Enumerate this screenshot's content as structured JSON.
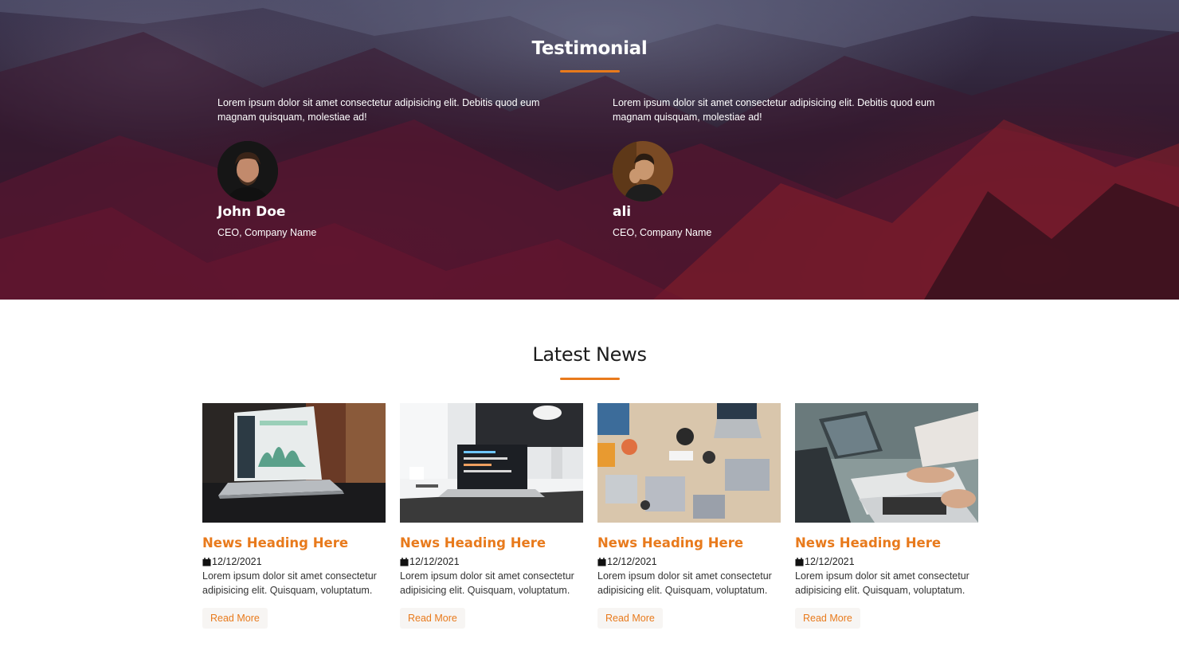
{
  "testimonial": {
    "title": "Testimonial",
    "items": [
      {
        "quote": "Lorem ipsum dolor sit amet consectetur adipisicing elit. Debitis quod eum magnam quisquam, molestiae ad!",
        "name": "John Doe",
        "role": "CEO, Company Name"
      },
      {
        "quote": "Lorem ipsum dolor sit amet consectetur adipisicing elit. Debitis quod eum magnam quisquam, molestiae ad!",
        "name": "ali",
        "role": "CEO, Company Name"
      }
    ]
  },
  "news": {
    "title": "Latest News",
    "items": [
      {
        "heading": "News Heading Here",
        "date": "12/12/2021",
        "text": "Lorem ipsum dolor sit amet consectetur adipisicing elit. Quisquam, voluptatum.",
        "button": "Read More"
      },
      {
        "heading": "News Heading Here",
        "date": "12/12/2021",
        "text": "Lorem ipsum dolor sit amet consectetur adipisicing elit. Quisquam, voluptatum.",
        "button": "Read More"
      },
      {
        "heading": "News Heading Here",
        "date": "12/12/2021",
        "text": "Lorem ipsum dolor sit amet consectetur adipisicing elit. Quisquam, voluptatum.",
        "button": "Read More"
      },
      {
        "heading": "News Heading Here",
        "date": "12/12/2021",
        "text": "Lorem ipsum dolor sit amet consectetur adipisicing elit. Quisquam, voluptatum.",
        "button": "Read More"
      }
    ]
  },
  "colors": {
    "accent": "#e87a1c",
    "button_bg": "#f7f5f3"
  },
  "icons": {
    "date": "calendar-icon"
  }
}
